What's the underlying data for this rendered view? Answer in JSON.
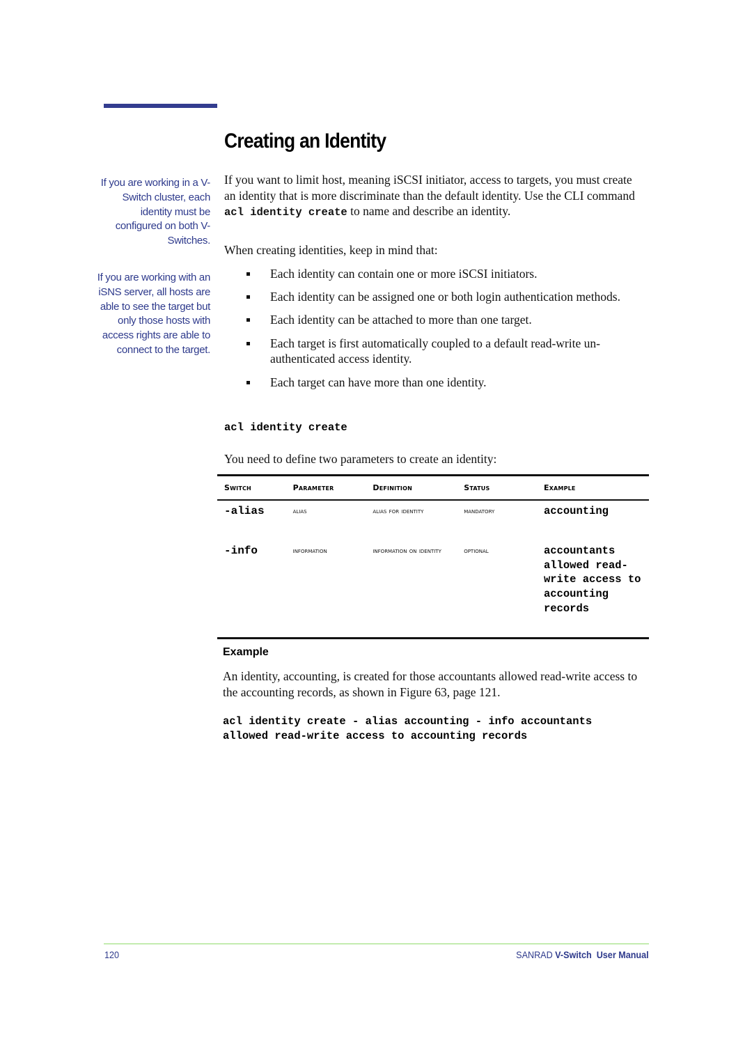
{
  "header": {
    "title": "Creating an Identity"
  },
  "sidebar_notes": [
    "If you are working in a V-Switch cluster, each identity must be configured on both V-Switches.",
    "If you are working with an iSNS server, all hosts are able to see the target but only those hosts with access rights are able to connect to the target."
  ],
  "intro": {
    "text_before_cmd": "If you want to limit host, meaning iSCSI initiator, access to targets, you must create an identity that is more discriminate than the default identity. Use the CLI command ",
    "cmd": "acl identity create",
    "text_after_cmd": " to name and describe an identity."
  },
  "keep_in_mind": "When creating identities, keep in mind that:",
  "bullets": [
    "Each identity can contain one or more iSCSI initiators.",
    "Each identity can be assigned one or both login authentication methods.",
    "Each identity can be attached to more than one target.",
    "Each target is first automatically coupled to a default read-write un-authenticated access identity.",
    "Each target can have more than one identity."
  ],
  "command_heading": "acl identity create",
  "params_intro": "You need to define two parameters to create an identity:",
  "table": {
    "headers": [
      "Switch",
      "Parameter",
      "Definition",
      "Status",
      "Example"
    ],
    "rows": [
      {
        "switch": "-alias",
        "parameter": "Alias",
        "definition": "Alias for Identity",
        "status": "Mandatory",
        "example": "accounting"
      },
      {
        "switch": "-info",
        "parameter": "Information",
        "definition": "Information on Identity",
        "status": "Optional",
        "example": "accountants allowed read-write access to accounting records"
      }
    ]
  },
  "example": {
    "heading": "Example",
    "text": "An identity, accounting, is created for those accountants allowed read-write access to the accounting records, as shown in Figure 63, page 121.",
    "code": "acl identity create - alias accounting - info accountants allowed read-write access to accounting records"
  },
  "footer": {
    "page_number": "120",
    "brand": "SANRAD ",
    "product": "V-Switch",
    "manual": "  User Manual",
    "accent_color": "#2e3a8c",
    "rule_color": "#8fdc6a"
  }
}
